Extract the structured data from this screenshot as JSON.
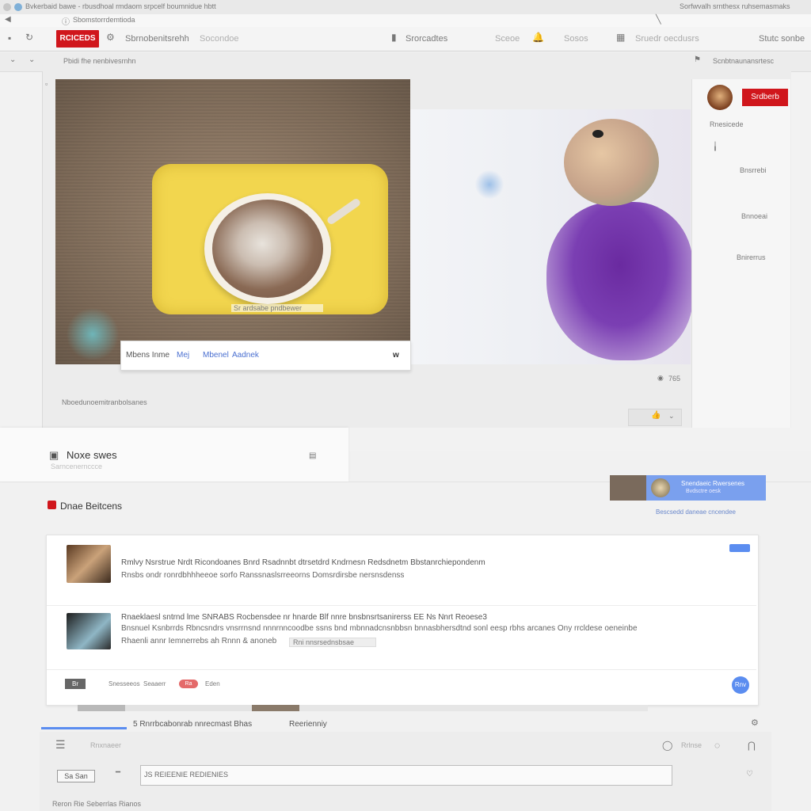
{
  "window": {
    "title": "Bvkerbaid bawe - rbusdhoal rmdaom srpcelf boumnidue hbtt",
    "address": "Sbomstorrdemtioda",
    "right_status": "Sorfwvalh srnthesx ruhsemasmaks"
  },
  "toolbar": {
    "red_button": "RCICEDS",
    "search_text": "Sbrnobenitsrehh",
    "search_hint": "Socondoe",
    "center_label": "Srorcadtes",
    "item_a": "Sceoe",
    "item_b": "Sosos",
    "right_text": "Sruedr oecdusrs",
    "far_right": "Stutc sonbe"
  },
  "subbar": {
    "left_text": "Pbidi fhe nenbivesrnhn",
    "right_text": "Scnbtnaunansrtesc"
  },
  "video": {
    "cup_label": "Sr ardsabe pndbewer",
    "caption_main": "Mbens Inme",
    "caption_link1": "Mej",
    "caption_link2": "Mbenel",
    "caption_link3": "Aadnek",
    "caption_close": "w",
    "below_text": "Nboedunoemitranbolsanes",
    "views": "765"
  },
  "sidebar": {
    "subscribe": "Srdberb",
    "channel": "Rnesicede",
    "item1": "Bnsrrebi",
    "item2": "Bnnoeai",
    "item3": "Bnirerrus"
  },
  "lower": {
    "section_title": "Noxe swes",
    "section_hint": "Sarncenernccce",
    "comments_title": "Dnae Beitcens",
    "ad_text": "Snendaeic Rwersenes",
    "ad_sub": "Bvdsctre oesk",
    "ad_link": "Bescsedd daneae cncendee"
  },
  "comments": [
    {
      "line1": "Rmlvy Nsrstrue Nrdt Ricondoanes Bnrd Rsadnnbt dtrsetdrd Kndrnesn Redsdnetm Bbstanrchiepondenm",
      "line2": "Rnsbs ondr ronrdbhhheeoe sorfo Ranssnaslsrreeorns Domsrdirsbe nersnsdenss"
    },
    {
      "line1": "Rnaeklaesl sntrnd lme SNRABS Rocbensdee nr hnarde Blf nnre bnsbnsrtsanirerss EE Ns Nnrt Reoese3",
      "line2": "Bnsnuel Ksnbrrds Rbncsndrs vnsrrnsnd nnnrnncoodbe ssns bnd mbnnadcnsnbbsn bnnasbhersdtnd sonl eesp rbhs arcanes Ony rrcldese oeneinbe",
      "line3": "Rhaenli annr Iemnerrebs ah Rnnn & anoneb",
      "line3_chip": "Rni nnsrsednsbsae"
    }
  ],
  "comments_footer": {
    "left_btn": "Br",
    "label1": "Snesseeos",
    "label2": "Seaaerr",
    "pill": "Ra",
    "label3": "Eden",
    "circle": "Rnv"
  },
  "bottom": {
    "tab1": "5 Rnrrbcabonrab nnrecmast Bhas",
    "tab2": "Reerienniy",
    "left_label": "Rnxnaeer",
    "right_label": "Rrlnse",
    "small_btn": "Sa San",
    "search_value": "JS REIEENIE REDIENIES",
    "footer": "Reron Rie Seberrlas Rianos"
  },
  "colors": {
    "accent_red": "#d0161c",
    "accent_blue": "#5b8df0"
  }
}
